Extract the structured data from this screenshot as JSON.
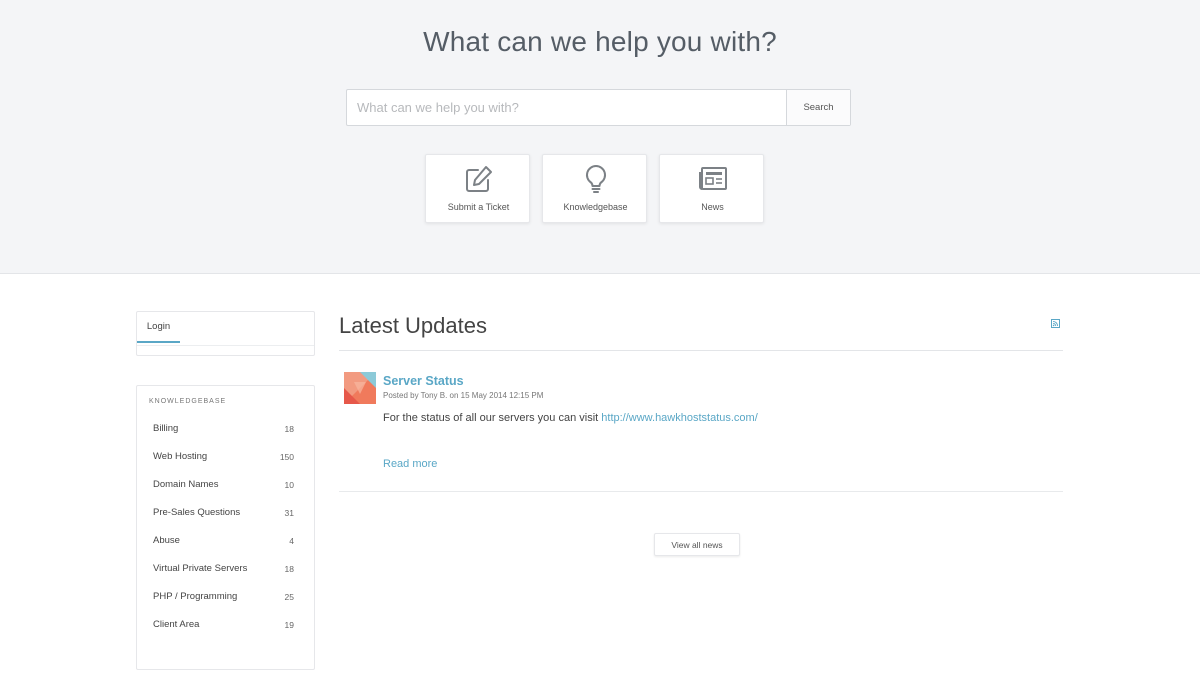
{
  "hero": {
    "title": "What can we help you with?",
    "search_placeholder": "What can we help you with?",
    "search_button": "Search",
    "tiles": [
      {
        "label": "Submit a Ticket",
        "icon": "edit-icon"
      },
      {
        "label": "Knowledgebase",
        "icon": "lightbulb-icon"
      },
      {
        "label": "News",
        "icon": "newspaper-icon"
      }
    ]
  },
  "sidebar": {
    "login_tab": "Login",
    "kb_heading": "KNOWLEDGEBASE",
    "kb_items": [
      {
        "label": "Billing",
        "count": "18"
      },
      {
        "label": "Web Hosting",
        "count": "150"
      },
      {
        "label": "Domain Names",
        "count": "10"
      },
      {
        "label": "Pre-Sales Questions",
        "count": "31"
      },
      {
        "label": "Abuse",
        "count": "4"
      },
      {
        "label": "Virtual Private Servers",
        "count": "18"
      },
      {
        "label": "PHP / Programming",
        "count": "25"
      },
      {
        "label": "Client Area",
        "count": "19"
      }
    ]
  },
  "main": {
    "title": "Latest Updates",
    "rss_icon": "rss-icon",
    "news": {
      "title": "Server Status",
      "meta": "Posted by Tony B. on 15 May 2014 12:15 PM",
      "body_text": "For the status of all our servers you can visit ",
      "body_link": "http://www.hawkhoststatus.com/",
      "read_more": "Read more"
    },
    "view_all": "View all news"
  },
  "colors": {
    "accent": "#5aa7c6",
    "hero_bg": "#f4f5f7"
  }
}
